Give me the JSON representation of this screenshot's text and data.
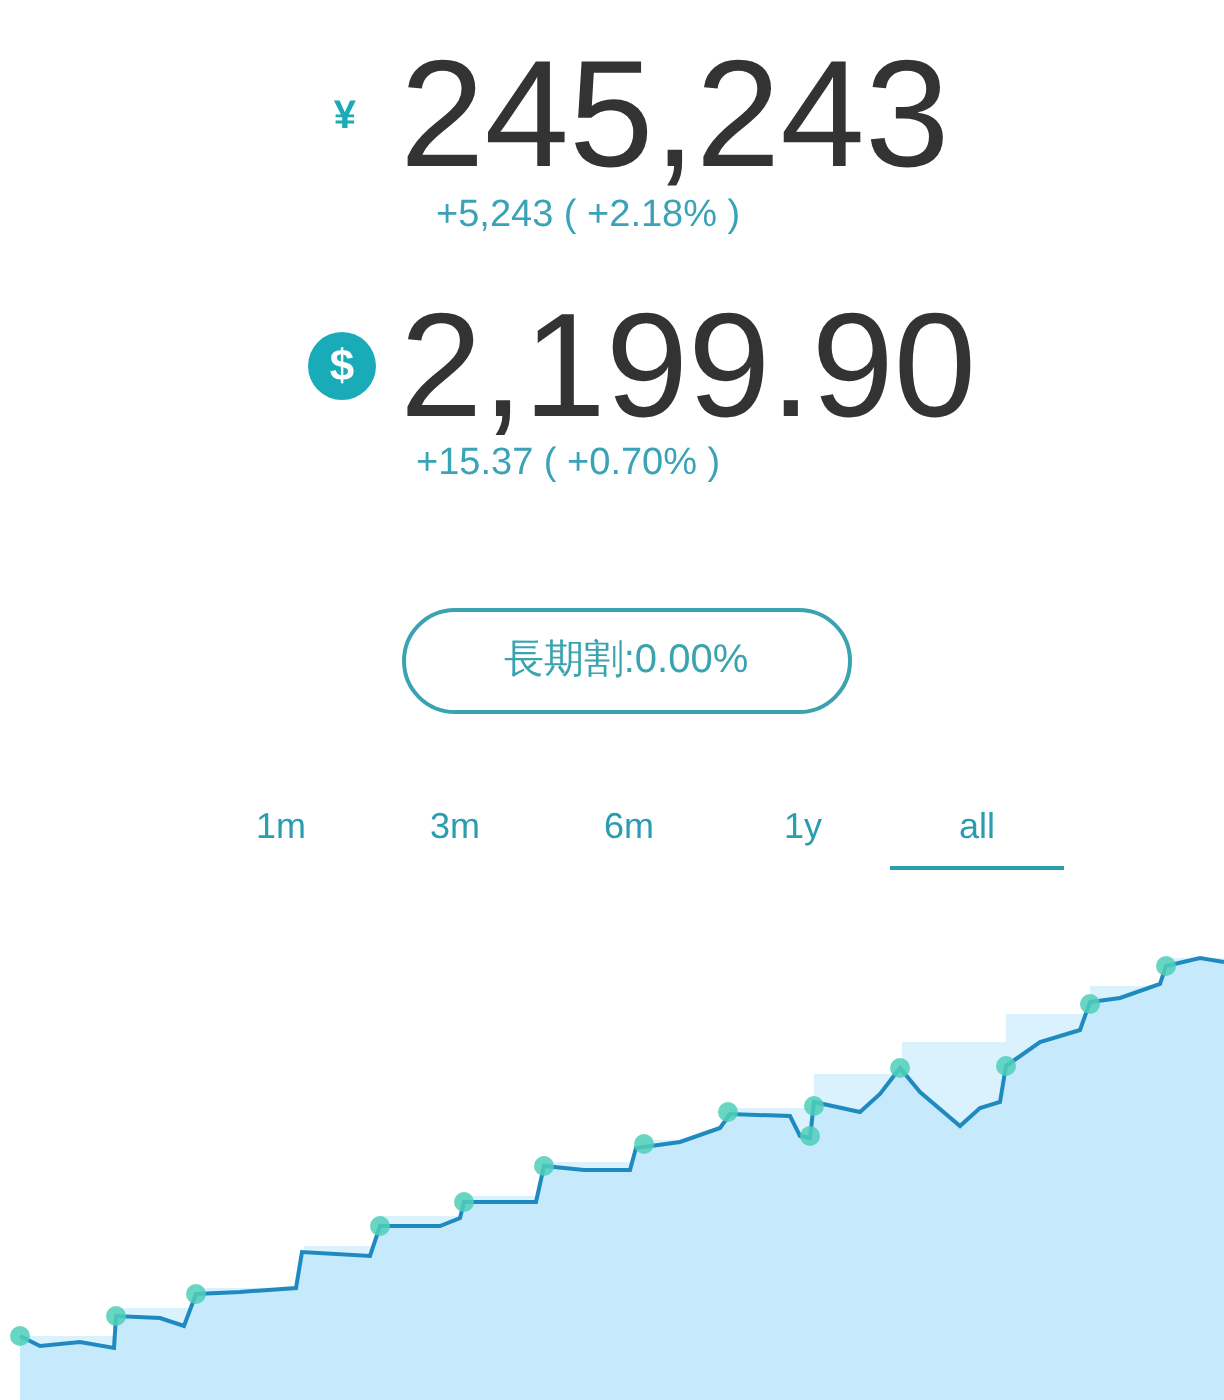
{
  "balances": [
    {
      "kind": "plain",
      "symbol": "¥",
      "amount": "245,243",
      "change": "+5,243 ( +2.18% )"
    },
    {
      "kind": "circle",
      "symbol": "$",
      "amount": "2,199.90",
      "change": "+15.37 ( +0.70% )"
    }
  ],
  "rate_pill": "長期割:0.00%",
  "tabs": [
    {
      "label": "1m",
      "selected": false
    },
    {
      "label": "3m",
      "selected": false
    },
    {
      "label": "6m",
      "selected": false
    },
    {
      "label": "1y",
      "selected": false
    },
    {
      "label": "all",
      "selected": true
    }
  ]
}
